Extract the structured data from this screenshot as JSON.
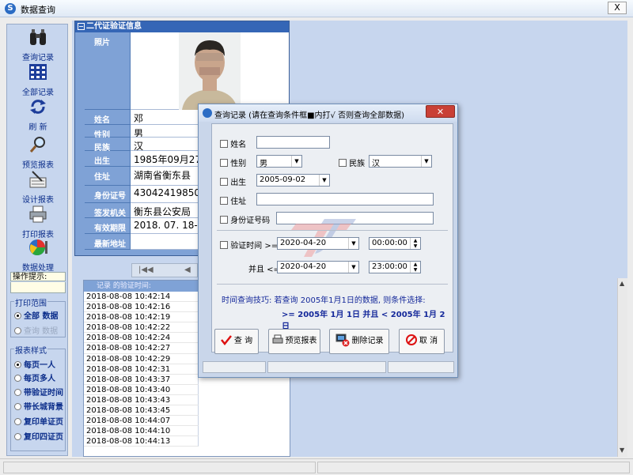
{
  "window": {
    "title": "数据查询",
    "close_glyph": "X"
  },
  "sidebar": {
    "tools": [
      {
        "label": "查询记录",
        "icon": "binoculars-icon"
      },
      {
        "label": "全部记录",
        "icon": "grid-icon"
      },
      {
        "label": "刷  新",
        "icon": "refresh-icon"
      },
      {
        "label": "预览报表",
        "icon": "magnifier-icon"
      },
      {
        "label": "设计报表",
        "icon": "design-report-icon"
      },
      {
        "label": "打印报表",
        "icon": "printer-icon"
      },
      {
        "label": "数据处理",
        "icon": "pie-chart-icon"
      }
    ],
    "tip_label": "操作提示:",
    "print_range": {
      "title": "打印范围",
      "options": [
        "全部 数据",
        "查询 数据"
      ],
      "selected": 0
    },
    "report_style": {
      "title": "报表样式",
      "options": [
        "每页一人",
        "每页多人",
        "带验证时间",
        "带长城背景",
        "复印单证页",
        "复印四证页"
      ],
      "selected": 0
    }
  },
  "id_card": {
    "header": "二代证验证信息",
    "photo_label": "照片",
    "fields": [
      {
        "label": "姓名",
        "value": "邓"
      },
      {
        "label": "性别",
        "value": "男"
      },
      {
        "label": "民族",
        "value": "汉"
      },
      {
        "label": "出生",
        "value": "1985年09月27日"
      },
      {
        "label": "住址",
        "value": "湖南省衡东县"
      },
      {
        "label": "身份证号",
        "value": "4304241985092"
      },
      {
        "label": "签发机关",
        "value": "衡东县公安局"
      },
      {
        "label": "有效期限",
        "value": "2018. 07. 18-20"
      },
      {
        "label": "最新地址",
        "value": ""
      }
    ]
  },
  "navigator": {
    "first": "|◀◀",
    "prev": "◀"
  },
  "time_list": {
    "header": "记录 的验证时间:",
    "rows": [
      "2018-08-08 10:42:14",
      "2018-08-08 10:42:16",
      "2018-08-08 10:42:19",
      "2018-08-08 10:42:22",
      "2018-08-08 10:42:24",
      "2018-08-08 10:42:27",
      "2018-08-08 10:42:29",
      "2018-08-08 10:42:31",
      "2018-08-08 10:43:37",
      "2018-08-08 10:43:40",
      "2018-08-08 10:43:43",
      "2018-08-08 10:43:45",
      "2018-08-08 10:44:07",
      "2018-08-08 10:44:10",
      "2018-08-08 10:44:13"
    ]
  },
  "dialog": {
    "title": "查询记录 (请在查询条件框■内打√  否则查询全部数据)",
    "name_label": "姓名",
    "name_value": "",
    "gender_label": "性别",
    "gender_value": "男",
    "ethnicity_label": "民族",
    "ethnicity_value": "汉",
    "birth_label": "出生",
    "birth_value": "2005-09-02",
    "address_label": "住址",
    "address_value": "",
    "idno_label": "身份证号码",
    "idno_value": "",
    "verify_label": "验证时间 >=",
    "verify_date_from": "2020-04-20",
    "verify_time_from": "00:00:00",
    "and_label": "并且 <=",
    "verify_date_to": "2020-04-20",
    "verify_time_to": "23:00:00",
    "hint_line1": "时间查询技巧: 若查询 2005年1月1日的数据, 则条件选择:",
    "hint_line2": ">= 2005年 1月 1日  并且 < 2005年 1月 2日",
    "buttons": {
      "query": "查 询",
      "preview": "预览报表",
      "delete": "删除记录",
      "cancel": "取 消"
    }
  }
}
